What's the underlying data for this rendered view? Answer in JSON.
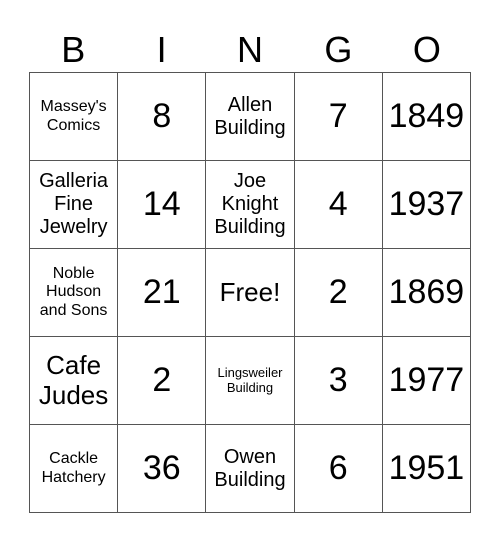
{
  "header": [
    "B",
    "I",
    "N",
    "G",
    "O"
  ],
  "cells": [
    [
      "Massey's Comics",
      "8",
      "Allen Building",
      "7",
      "1849"
    ],
    [
      "Galleria Fine Jewelry",
      "14",
      "Joe Knight Building",
      "4",
      "1937"
    ],
    [
      "Noble Hudson and Sons",
      "21",
      "Free!",
      "2",
      "1869"
    ],
    [
      "Cafe Judes",
      "2",
      "Lingsweiler Building",
      "3",
      "1977"
    ],
    [
      "Cackle Hatchery",
      "36",
      "Owen Building",
      "6",
      "1951"
    ]
  ]
}
